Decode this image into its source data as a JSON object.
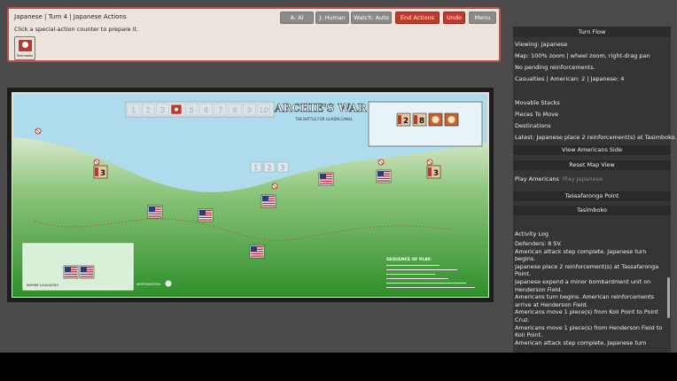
{
  "header": {
    "status": "Japanese | Turn 4 | Japanese Actions",
    "hint": "Click a special-action counter to prepare it.",
    "buttons": {
      "ai": "A: AI",
      "human": "J: Human",
      "watch": "Watch: Auto",
      "end_actions": "End Actions",
      "undo": "Undo",
      "menu": "Menu"
    },
    "special_counter_label": "Tasimboko"
  },
  "board": {
    "title": "ARCHIE'S WAR",
    "subtitle": "THE BATTLE FOR GUADALCANAL",
    "turn_track": [
      "1",
      "2",
      "3",
      "4",
      "5",
      "6",
      "7",
      "8",
      "9",
      "10"
    ],
    "reinforcement_track": [
      "1",
      "2",
      "3"
    ],
    "counter_values": [
      "2",
      "8",
      "3",
      "3"
    ],
    "box_labels": {
      "marine_casualties": "MARINE CASUALTIES",
      "sequence_title": "SEQUENCE OF PLAY:"
    },
    "publisher": "WORTHINGTON"
  },
  "side": {
    "turn_flow_title": "Turn Flow",
    "viewing": "Viewing: Japanese",
    "map_info": "Map: 100% zoom | wheel zoom, right-drag pan",
    "reinforcements": "No pending reinforcements.",
    "casualties": "Casualties | American: 2 | Japanese: 4",
    "movable_stacks": "Movable Stacks",
    "pieces_to_move": "Pieces To Move",
    "destinations": "Destinations",
    "latest": "Latest: Japanese place 2 reinforcement(s) at Tasimboko.",
    "view_americans": "View Americans Side",
    "reset_map": "Reset Map View",
    "play_americans": "Play Americans",
    "play_japanese": "Play Japanese",
    "dest_1": "Tassafaronga Point",
    "dest_2": "Tasimboko",
    "activity_title": "Activity Log",
    "log": [
      "Defenders: 8 SV.",
      "American attack step complete. Japanese turn begins.",
      "Japanese place 2 reinforcement(s) at Tassafaronga Point.",
      "Japanese expend a minor bombardment unit on Henderson Field.",
      "Americans turn begins. American reinforcements arrive at Henderson Field.",
      "Americans move 1 piece(s) from Koli Point to Point Cruz.",
      "Americans move 1 piece(s) from Henderson Field to Koli Point.",
      "American attack step complete. Japanese turn begins."
    ]
  },
  "colors": {
    "accent_red": "#c0392b",
    "sea": "#aedcec",
    "jungle": "#3f9e36"
  }
}
